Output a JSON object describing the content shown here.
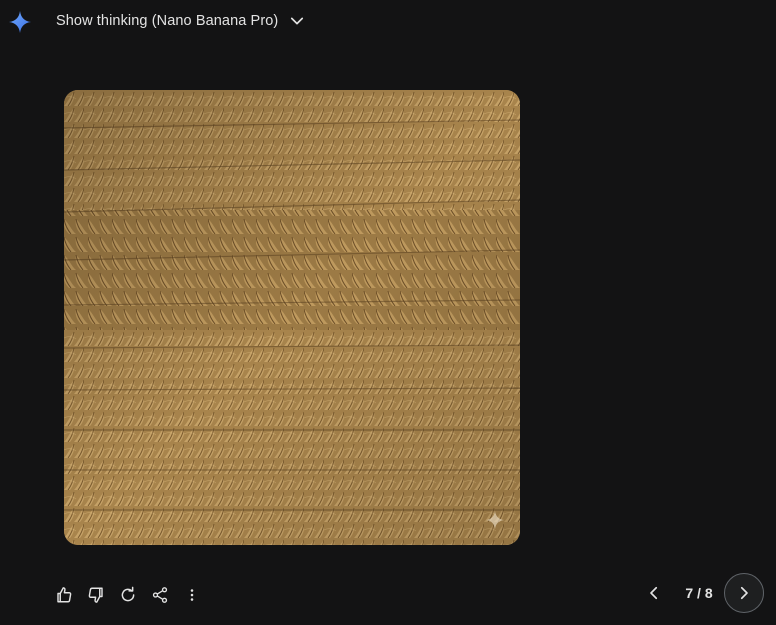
{
  "header": {
    "logo_icon": "gemini-spark-icon",
    "thinking_label": "Show thinking (Nano Banana Pro)",
    "expand_icon": "chevron-down-icon"
  },
  "image": {
    "description_icon": "generated-image",
    "watermark_icon": "sparkle-watermark-icon",
    "colors": {
      "base": "#a8844c",
      "light": "#c9a66b",
      "dark": "#6b4f28"
    }
  },
  "actions": [
    {
      "icon": "thumbs-up-icon"
    },
    {
      "icon": "thumbs-down-icon"
    },
    {
      "icon": "regenerate-icon"
    },
    {
      "icon": "share-icon"
    },
    {
      "icon": "more-vertical-icon"
    }
  ],
  "pager": {
    "prev_icon": "chevron-left-icon",
    "counter": "7 / 8",
    "next_icon": "chevron-right-icon"
  },
  "colors": {
    "background": "#131314",
    "text": "#e3e3e3",
    "accent": "#4f8df7"
  }
}
